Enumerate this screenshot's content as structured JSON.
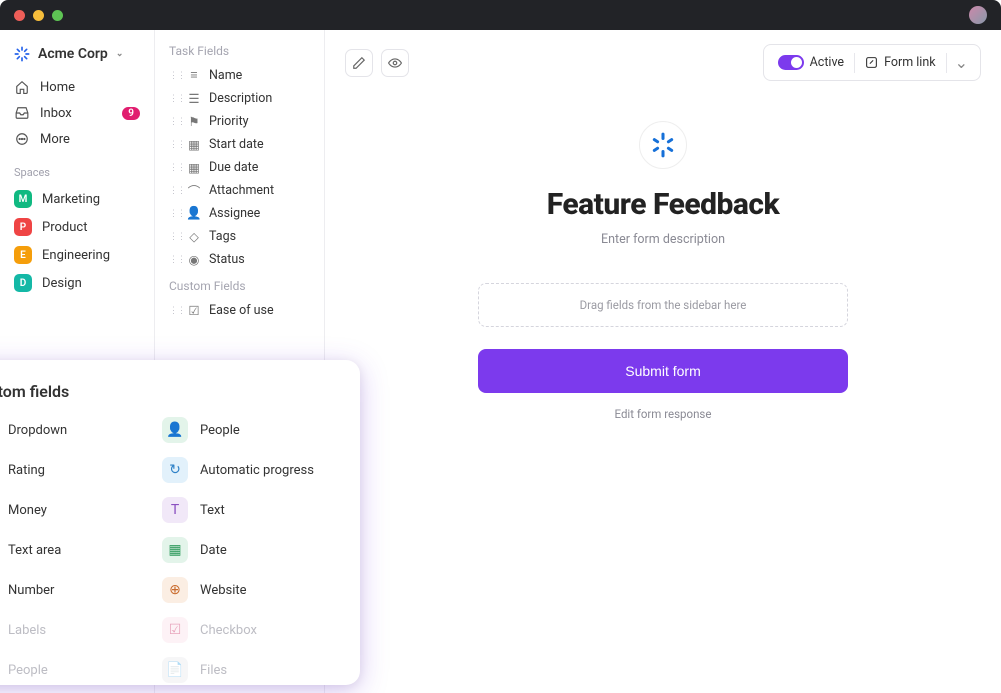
{
  "workspace": {
    "name": "Acme Corp"
  },
  "nav": {
    "home": "Home",
    "inbox": "Inbox",
    "inbox_badge": "9",
    "more": "More"
  },
  "spaces": {
    "label": "Spaces",
    "items": [
      {
        "letter": "M",
        "name": "Marketing"
      },
      {
        "letter": "P",
        "name": "Product"
      },
      {
        "letter": "E",
        "name": "Engineering"
      },
      {
        "letter": "D",
        "name": "Design"
      }
    ]
  },
  "fields": {
    "task_header": "Task Fields",
    "task": [
      "Name",
      "Description",
      "Priority",
      "Start date",
      "Due date",
      "Attachment",
      "Assignee",
      "Tags",
      "Status"
    ],
    "custom_header": "Custom Fields",
    "custom": [
      "Ease of use"
    ]
  },
  "toolbar": {
    "active": "Active",
    "formlink": "Form link"
  },
  "form": {
    "title": "Feature Feedback",
    "desc": "Enter form description",
    "dropzone": "Drag fields from the sidebar here",
    "submit": "Submit form",
    "edit_response": "Edit form response"
  },
  "popover": {
    "title": "Custom fields",
    "left": [
      {
        "label": "Dropdown",
        "bg": "#ece9fb",
        "fg": "#6d4fe0",
        "glyph": "▾"
      },
      {
        "label": "Rating",
        "bg": "#fff5dc",
        "fg": "#d99a1f",
        "glyph": "☆"
      },
      {
        "label": "Money",
        "bg": "#e3f4ea",
        "fg": "#2f9a5d",
        "glyph": "$"
      },
      {
        "label": "Text area",
        "bg": "#efeff2",
        "fg": "#74747d",
        "glyph": "¶"
      },
      {
        "label": "Number",
        "bg": "#e7edfb",
        "fg": "#4364d3",
        "glyph": "#"
      },
      {
        "label": "Labels",
        "bg": "#fce9ef",
        "fg": "#d65c88",
        "glyph": "◇",
        "faded": true
      },
      {
        "label": "People",
        "bg": "#efeff2",
        "fg": "#74747d",
        "glyph": "👤",
        "faded": true
      }
    ],
    "right": [
      {
        "label": "People",
        "bg": "#e3f4ea",
        "fg": "#2f9a5d",
        "glyph": "👤"
      },
      {
        "label": "Automatic progress",
        "bg": "#e2f1fb",
        "fg": "#2e81c7",
        "glyph": "↻"
      },
      {
        "label": "Text",
        "bg": "#f1e8f8",
        "fg": "#8a4fc0",
        "glyph": "T"
      },
      {
        "label": "Date",
        "bg": "#e3f4ea",
        "fg": "#2f9a5d",
        "glyph": "▦"
      },
      {
        "label": "Website",
        "bg": "#fbeee3",
        "fg": "#c96a2c",
        "glyph": "⊕"
      },
      {
        "label": "Checkbox",
        "bg": "#fce9ef",
        "fg": "#d65c88",
        "glyph": "☑",
        "faded": true
      },
      {
        "label": "Files",
        "bg": "#efeff2",
        "fg": "#74747d",
        "glyph": "📄",
        "faded": true
      }
    ]
  }
}
